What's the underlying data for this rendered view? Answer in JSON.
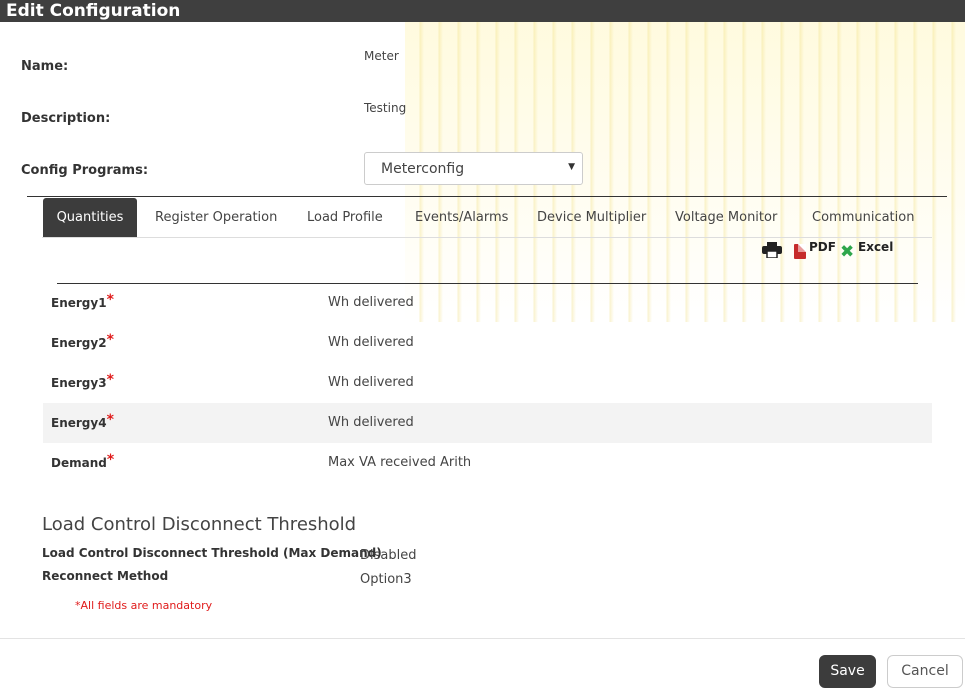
{
  "window": {
    "title": "Edit Configuration"
  },
  "form": {
    "name_label": "Name:",
    "name_value": "Meter",
    "description_label": "Description:",
    "description_value": "Testing",
    "config_label": "Config Programs:",
    "config_selected": "Meterconfig"
  },
  "tabs": [
    {
      "label": "Quantities",
      "active": true
    },
    {
      "label": "Register Operation"
    },
    {
      "label": "Load Profile"
    },
    {
      "label": "Events/Alarms"
    },
    {
      "label": "Device Multiplier"
    },
    {
      "label": "Voltage Monitor"
    },
    {
      "label": "Communication"
    }
  ],
  "export": {
    "print_icon": "printer-icon",
    "pdf_label": "PDF",
    "excel_label": "Excel"
  },
  "quantities": [
    {
      "name": "Energy1",
      "required": "*",
      "value": "Wh delivered"
    },
    {
      "name": "Energy2",
      "required": "*",
      "value": "Wh delivered"
    },
    {
      "name": "Energy3",
      "required": "*",
      "value": "Wh delivered"
    },
    {
      "name": "Energy4",
      "required": "*",
      "value": "Wh delivered"
    },
    {
      "name": "Demand",
      "required": "*",
      "value": "Max VA received Arith"
    }
  ],
  "load_control": {
    "title": "Load Control Disconnect Threshold",
    "threshold_label": "Load Control Disconnect Threshold (Max Demand)",
    "threshold_value": "Disabled",
    "reconnect_label": "Reconnect Method",
    "reconnect_value": "Option3"
  },
  "mandatory_note": {
    "star": "*",
    "text": "All fields are mandatory"
  },
  "footer": {
    "save_label": "Save",
    "cancel_label": "Cancel"
  },
  "colors": {
    "header": "#3f3f3f",
    "active_tab": "#3c3c3c",
    "required": "#e01b1b",
    "excel": "#2ea64b",
    "pdf": "#c62b2b"
  }
}
